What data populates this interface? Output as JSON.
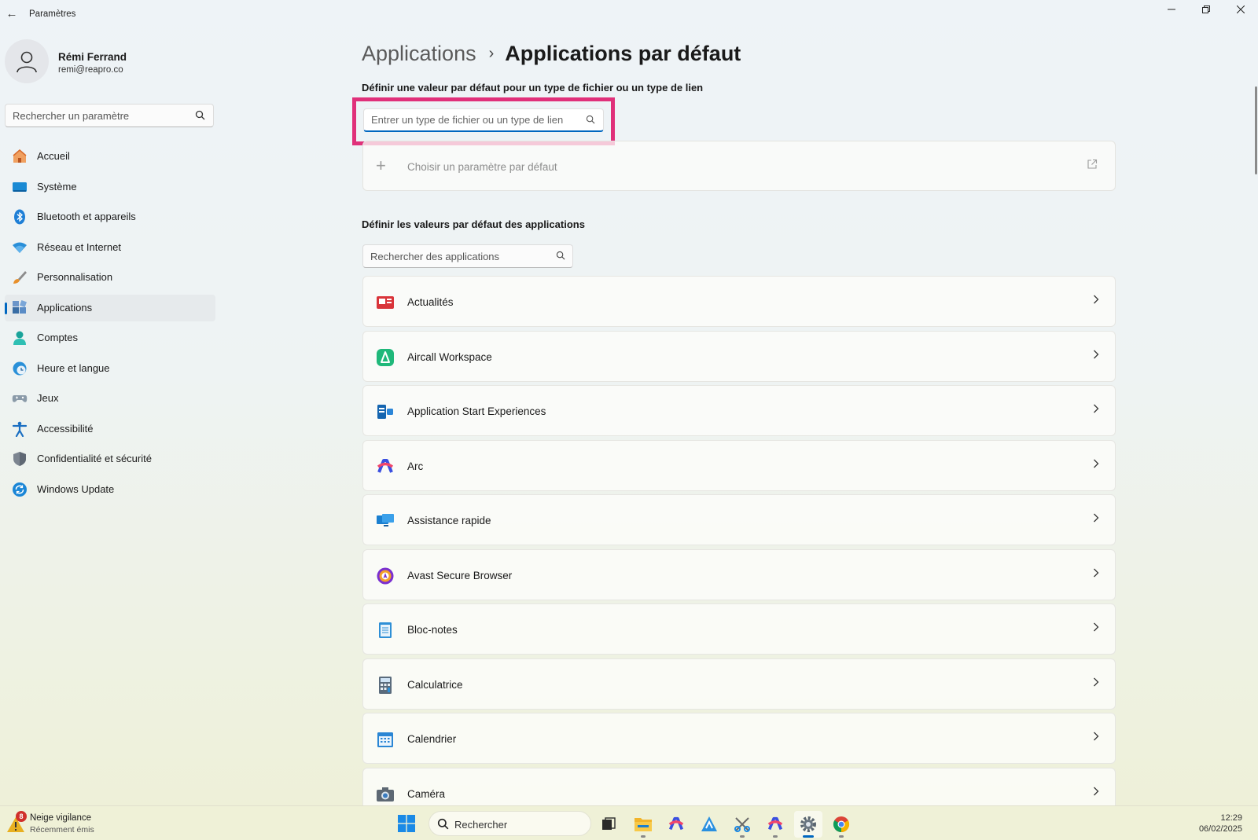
{
  "window": {
    "title": "Paramètres",
    "back_glyph": "←",
    "controls": [
      "minimize-icon",
      "restore-icon",
      "close-icon"
    ]
  },
  "profile": {
    "name": "Rémi Ferrand",
    "email": "remi@reapro.co"
  },
  "sidebar": {
    "search_placeholder": "Rechercher un paramètre",
    "items": [
      {
        "label": "Accueil",
        "icon": "home-icon"
      },
      {
        "label": "Système",
        "icon": "system-icon"
      },
      {
        "label": "Bluetooth et appareils",
        "icon": "bluetooth-icon"
      },
      {
        "label": "Réseau et Internet",
        "icon": "wifi-icon"
      },
      {
        "label": "Personnalisation",
        "icon": "brush-icon"
      },
      {
        "label": "Applications",
        "icon": "apps-icon",
        "active": true
      },
      {
        "label": "Comptes",
        "icon": "account-icon"
      },
      {
        "label": "Heure et langue",
        "icon": "clock-globe-icon"
      },
      {
        "label": "Jeux",
        "icon": "gamepad-icon"
      },
      {
        "label": "Accessibilité",
        "icon": "accessibility-icon"
      },
      {
        "label": "Confidentialité et sécurité",
        "icon": "shield-icon"
      },
      {
        "label": "Windows Update",
        "icon": "update-icon"
      }
    ]
  },
  "main": {
    "breadcrumb": {
      "parent": "Applications",
      "separator": "›",
      "current": "Applications par défaut"
    },
    "file_type_section": {
      "title": "Définir une valeur par défaut pour un type de fichier ou un type de lien",
      "input_placeholder": "Entrer un type de fichier ou un type de lien",
      "choose_default_label": "Choisir un paramètre par défaut"
    },
    "apps_section": {
      "title": "Définir les valeurs par défaut des applications",
      "search_placeholder": "Rechercher des applications",
      "apps": [
        {
          "label": "Actualités",
          "icon": "news-icon"
        },
        {
          "label": "Aircall Workspace",
          "icon": "aircall-icon"
        },
        {
          "label": "Application Start Experiences",
          "icon": "start-experiences-icon"
        },
        {
          "label": "Arc",
          "icon": "arc-icon"
        },
        {
          "label": "Assistance rapide",
          "icon": "quick-assist-icon"
        },
        {
          "label": "Avast Secure Browser",
          "icon": "avast-icon"
        },
        {
          "label": "Bloc-notes",
          "icon": "notepad-icon"
        },
        {
          "label": "Calculatrice",
          "icon": "calculator-icon"
        },
        {
          "label": "Calendrier",
          "icon": "calendar-icon"
        },
        {
          "label": "Caméra",
          "icon": "camera-icon"
        }
      ]
    }
  },
  "taskbar": {
    "weather": {
      "badge": "8",
      "title": "Neige vigilance",
      "subtitle": "Récemment émis"
    },
    "search_placeholder": "Rechercher",
    "apps": [
      "task-view-icon",
      "file-explorer-icon",
      "arc-icon",
      "aircall-icon",
      "snipping-tool-icon",
      "arc-icon",
      "settings-icon",
      "chrome-icon"
    ],
    "clock": {
      "time": "12:29",
      "date": "06/02/2025"
    }
  },
  "colors": {
    "accent": "#0067c0",
    "highlight_box": "#e0307a"
  }
}
